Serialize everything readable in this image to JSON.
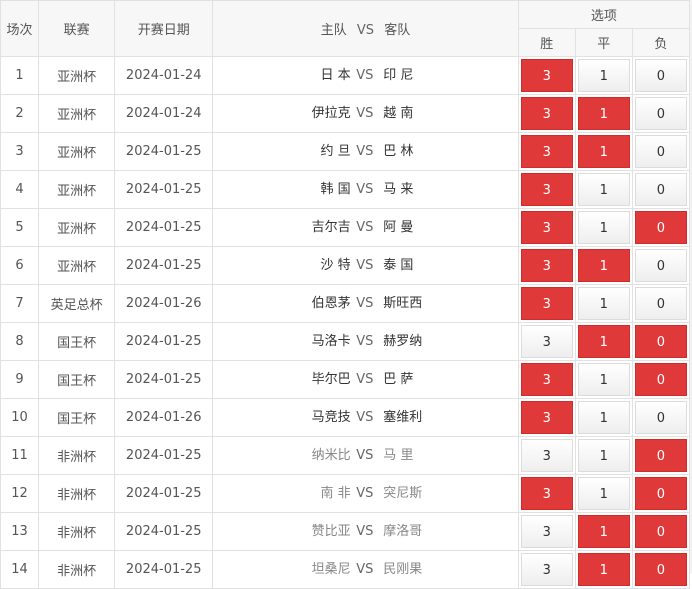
{
  "header": {
    "no": "场次",
    "league": "联赛",
    "date": "开赛日期",
    "home": "主队",
    "vs": "VS",
    "away": "客队",
    "options": "选项",
    "win": "胜",
    "draw": "平",
    "lose": "负"
  },
  "rows": [
    {
      "no": "1",
      "league": "亚洲杯",
      "date": "2024-01-24",
      "home": "日 本",
      "vs": "VS",
      "away": "印 尼",
      "win": "3",
      "draw": "1",
      "lose": "0",
      "sel": [
        true,
        false,
        false
      ],
      "muted": false
    },
    {
      "no": "2",
      "league": "亚洲杯",
      "date": "2024-01-24",
      "home": "伊拉克",
      "vs": "VS",
      "away": "越 南",
      "win": "3",
      "draw": "1",
      "lose": "0",
      "sel": [
        true,
        true,
        false
      ],
      "muted": false
    },
    {
      "no": "3",
      "league": "亚洲杯",
      "date": "2024-01-25",
      "home": "约 旦",
      "vs": "VS",
      "away": "巴 林",
      "win": "3",
      "draw": "1",
      "lose": "0",
      "sel": [
        true,
        true,
        false
      ],
      "muted": false
    },
    {
      "no": "4",
      "league": "亚洲杯",
      "date": "2024-01-25",
      "home": "韩 国",
      "vs": "VS",
      "away": "马 来",
      "win": "3",
      "draw": "1",
      "lose": "0",
      "sel": [
        true,
        false,
        false
      ],
      "muted": false
    },
    {
      "no": "5",
      "league": "亚洲杯",
      "date": "2024-01-25",
      "home": "吉尔吉",
      "vs": "VS",
      "away": "阿 曼",
      "win": "3",
      "draw": "1",
      "lose": "0",
      "sel": [
        true,
        false,
        true
      ],
      "muted": false
    },
    {
      "no": "6",
      "league": "亚洲杯",
      "date": "2024-01-25",
      "home": "沙 特",
      "vs": "VS",
      "away": "泰 国",
      "win": "3",
      "draw": "1",
      "lose": "0",
      "sel": [
        true,
        true,
        false
      ],
      "muted": false
    },
    {
      "no": "7",
      "league": "英足总杯",
      "date": "2024-01-26",
      "home": "伯恩茅",
      "vs": "VS",
      "away": "斯旺西",
      "win": "3",
      "draw": "1",
      "lose": "0",
      "sel": [
        true,
        false,
        false
      ],
      "muted": false
    },
    {
      "no": "8",
      "league": "国王杯",
      "date": "2024-01-25",
      "home": "马洛卡",
      "vs": "VS",
      "away": "赫罗纳",
      "win": "3",
      "draw": "1",
      "lose": "0",
      "sel": [
        false,
        true,
        true
      ],
      "muted": false
    },
    {
      "no": "9",
      "league": "国王杯",
      "date": "2024-01-25",
      "home": "毕尔巴",
      "vs": "VS",
      "away": "巴 萨",
      "win": "3",
      "draw": "1",
      "lose": "0",
      "sel": [
        true,
        false,
        true
      ],
      "muted": false
    },
    {
      "no": "10",
      "league": "国王杯",
      "date": "2024-01-26",
      "home": "马竞技",
      "vs": "VS",
      "away": "塞维利",
      "win": "3",
      "draw": "1",
      "lose": "0",
      "sel": [
        true,
        false,
        false
      ],
      "muted": false
    },
    {
      "no": "11",
      "league": "非洲杯",
      "date": "2024-01-25",
      "home": "纳米比",
      "vs": "VS",
      "away": "马 里",
      "win": "3",
      "draw": "1",
      "lose": "0",
      "sel": [
        false,
        false,
        true
      ],
      "muted": true
    },
    {
      "no": "12",
      "league": "非洲杯",
      "date": "2024-01-25",
      "home": "南 非",
      "vs": "VS",
      "away": "突尼斯",
      "win": "3",
      "draw": "1",
      "lose": "0",
      "sel": [
        true,
        false,
        true
      ],
      "muted": true
    },
    {
      "no": "13",
      "league": "非洲杯",
      "date": "2024-01-25",
      "home": "赞比亚",
      "vs": "VS",
      "away": "摩洛哥",
      "win": "3",
      "draw": "1",
      "lose": "0",
      "sel": [
        false,
        true,
        true
      ],
      "muted": true
    },
    {
      "no": "14",
      "league": "非洲杯",
      "date": "2024-01-25",
      "home": "坦桑尼",
      "vs": "VS",
      "away": "民刚果",
      "win": "3",
      "draw": "1",
      "lose": "0",
      "sel": [
        false,
        true,
        true
      ],
      "muted": true
    }
  ]
}
